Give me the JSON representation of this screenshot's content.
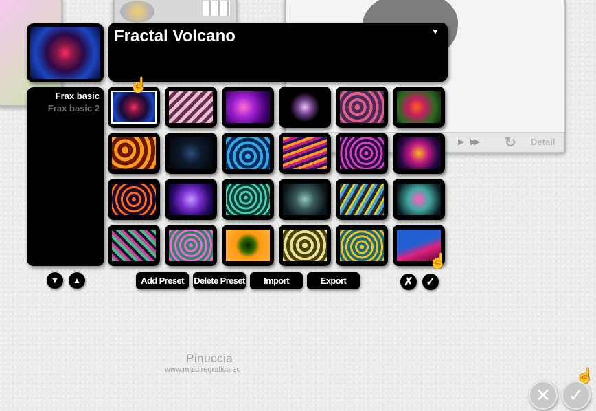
{
  "preset": {
    "title": "Fractal Volcano",
    "dropdown_icon": "triangle-down-icon"
  },
  "categories": [
    {
      "label": "Frax basic",
      "selected": true
    },
    {
      "label": "Frax basic 2",
      "selected": false
    }
  ],
  "thumbnails": [
    [
      "radial-gradient(circle at 50% 50%,#ff2a60 0,#7a1540 20%,#180a38 48%,#1a46c0 75%,#0a0a30 100%)",
      "repeating-linear-gradient(135deg,#e8c0d4 0 5px,#6a2c4c 5px 10px)",
      "radial-gradient(circle at 40% 50%,#ff70d0 0,#a020d0 35%,#400070 75%,#1a0030 100%)",
      "radial-gradient(circle at 50% 50%,#e8c0f0 0,#7a4a98 25%,#000 55%)",
      "repeating-radial-gradient(circle at 40% 50%,#e06080 0 4px,#4a2860 4px 9px)",
      "radial-gradient(circle at 45% 50%,#ff6020 0,#c02060 30%,#2a6a20 65%,#102010 100%)"
    ],
    [
      "repeating-radial-gradient(circle at 30% 40%,#ff9a20 0 5px,#6a1800 5px 11px)",
      "radial-gradient(circle at 50% 50%,#2a4a7a 0,#0e1a2c 40%,#02040a 100%)",
      "repeating-radial-gradient(circle at 50% 60%,#30a8e8 0 4px,#0a2a5a 4px 9px)",
      "repeating-linear-gradient(160deg,#ff9a20 0 4px,#c02080 4px 8px,#2a1060 8px 12px)",
      "repeating-radial-gradient(circle at 60% 50%,#d040c0 0 3px,#2a0840 3px 7px)",
      "radial-gradient(circle at 50% 50%,#ffb020 0,#c01a80 35%,#2a0a4a 70%,#080010 100%)"
    ],
    [
      "repeating-radial-gradient(circle at 50% 50%,#ff6a10 0 3px,#1a0a30 3px 8px)",
      "radial-gradient(circle at 50% 50%,#c0a0ff 0,#7a30d0 35%,#2a0a6a 70%,#0a0020 100%)",
      "repeating-radial-gradient(circle at 45% 45%,#4ad0a8 0 3px,#0a3a3a 3px 7px)",
      "radial-gradient(circle at 50% 50%,#90c8c0 0,#3a5a5a 35%,#0a1418 80%)",
      "repeating-linear-gradient(120deg,#2a2a2a 0 5px,#e0d020 5px 8px,#40a0e0 8px 12px)",
      "radial-gradient(circle at 50% 50%,#ff60c0 0,#40a8a0 40%,#0a1820 85%)"
    ],
    [
      "repeating-linear-gradient(45deg,#40c080 0 4px,#d040a0 4px 8px,#201030 8px 12px)",
      "repeating-radial-gradient(circle at 50% 50%,#ff60e0 0 3px,#2a8a60 3px 7px)",
      "radial-gradient(circle at 50% 50%,#102000 0,#2a6a00 25%,#ff9a10 45%,#ffb040 100%)",
      "repeating-radial-gradient(circle at 50% 50%,#e8e090 0 4px,#4a4010 4px 9px)",
      "repeating-radial-gradient(circle at 50% 55%,#f0c020 0 3px,#1a6a7a 3px 7px)",
      "linear-gradient(160deg,#2060d0 0,#2060d0 45%,#e02080 65%,#5a0830 100%)"
    ]
  ],
  "actions": {
    "add_preset": "Add Preset",
    "delete_preset": "Delete Preset",
    "import": "Import",
    "export": "Export"
  },
  "icons": {
    "down": "arrow-down-icon",
    "up": "arrow-up-icon",
    "cancel": "x-icon",
    "ok": "checkmark-icon",
    "pointer": "pointing-hand-icon",
    "play": "play-icon",
    "fast_forward": "fast-forward-icon",
    "reset": "reset-icon"
  },
  "background": {
    "detail_label": "Detail"
  },
  "bottom": {
    "cancel_glyph": "✕",
    "ok_glyph": "✓"
  },
  "glyphs": {
    "down": "▼",
    "up": "▲",
    "x": "✗",
    "check": "✓",
    "hand": "☝",
    "triangle": "▼",
    "play": "▶",
    "ff": "▶▶",
    "reset": "↻"
  },
  "watermark": {
    "name": "Pinuccia",
    "url": "www.maidiregrafica.eu"
  }
}
